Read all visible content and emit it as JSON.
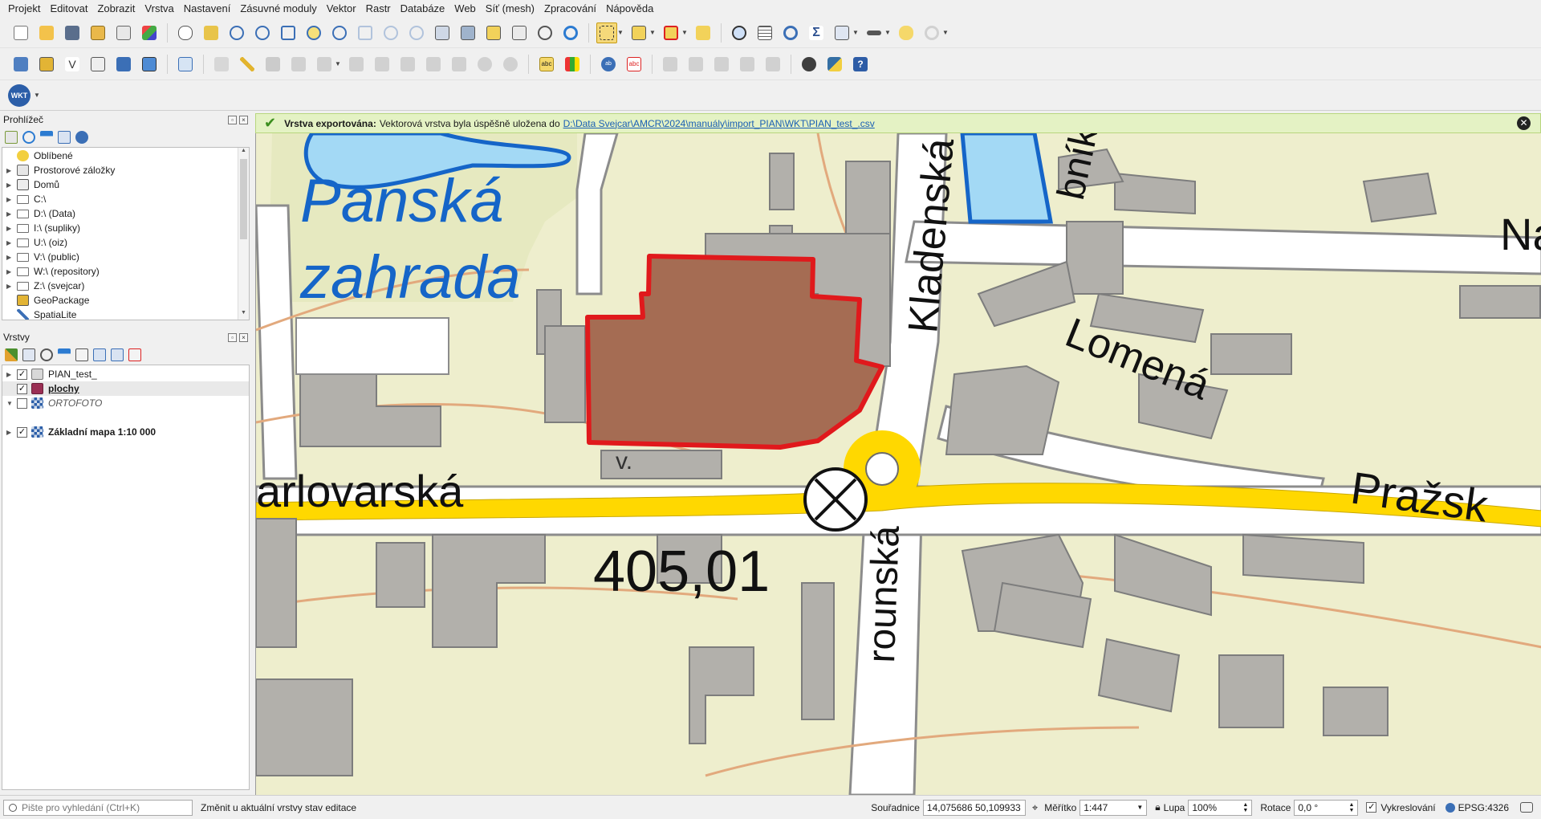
{
  "menu": [
    "Projekt",
    "Editovat",
    "Zobrazit",
    "Vrstva",
    "Nastavení",
    "Zásuvné moduly",
    "Vektor",
    "Rastr",
    "Databáze",
    "Web",
    "Síť (mesh)",
    "Zpracování",
    "Nápověda"
  ],
  "wkt_label": "WKT",
  "browser": {
    "title": "Prohlížeč",
    "items": [
      {
        "label": "Oblíbené",
        "icon": "star-icon",
        "expandable": false
      },
      {
        "label": "Prostorové záložky",
        "icon": "bookmarks-icon",
        "expandable": true
      },
      {
        "label": "Domů",
        "icon": "home-icon",
        "expandable": true
      },
      {
        "label": "C:\\",
        "icon": "folder-icon",
        "expandable": true
      },
      {
        "label": "D:\\ (Data)",
        "icon": "folder-icon",
        "expandable": true
      },
      {
        "label": "I:\\ (supliky)",
        "icon": "folder-icon",
        "expandable": true
      },
      {
        "label": "U:\\ (oiz)",
        "icon": "folder-icon",
        "expandable": true
      },
      {
        "label": "V:\\ (public)",
        "icon": "folder-icon",
        "expandable": true
      },
      {
        "label": "W:\\ (repository)",
        "icon": "folder-icon",
        "expandable": true
      },
      {
        "label": "Z:\\ (svejcar)",
        "icon": "folder-icon",
        "expandable": true
      },
      {
        "label": "GeoPackage",
        "icon": "geopackage-icon",
        "expandable": false
      },
      {
        "label": "SpatiaLite",
        "icon": "spatialite-icon",
        "expandable": false
      }
    ]
  },
  "layers": {
    "title": "Vrstvy",
    "items": [
      {
        "label": "PIAN_test_",
        "checked": true,
        "style": "normal"
      },
      {
        "label": "plochy",
        "checked": true,
        "style": "bold-underline"
      },
      {
        "label": "ORTOFOTO",
        "checked": false,
        "style": "italic"
      },
      {
        "label": "Základní mapa 1:10 000",
        "checked": true,
        "style": "bold"
      }
    ]
  },
  "message": {
    "title": "Vrstva exportována:",
    "text": "Vektorová vrstva byla úspěšně uložena do",
    "link": "D:\\Data Svejcar\\AMCR\\2024\\manuály\\import_PIAN\\WKT\\PIAN_test_.csv"
  },
  "map_labels": {
    "park1": "Panská",
    "park2": "zahrada",
    "street_kladenska": "Kladenská",
    "street_lomena": "Lomená",
    "street_karlovarska": "arlovarská",
    "street_prazska": "Pražsk",
    "street_rounska": "rounská",
    "street_rybniku": "bníku",
    "street_na": "Na",
    "spot_height": "405,01",
    "station_label": "v."
  },
  "status": {
    "search_placeholder": "Pište pro vyhledání (Ctrl+K)",
    "message": "Změnit u aktuální vrstvy stav editace",
    "coord_label": "Souřadnice",
    "coord_value": "14,075686 50,109933",
    "scale_label": "Měřítko",
    "scale_value": "1:447",
    "magnifier_label": "Lupa",
    "magnifier_value": "100%",
    "rotation_label": "Rotace",
    "rotation_value": "0,0 °",
    "render_label": "Vykreslování",
    "crs": "EPSG:4326"
  },
  "colors": {
    "polygon_fill": "#a56c53",
    "polygon_stroke": "#e0191c",
    "building": "#b2b0ab",
    "road_yellow": "#ffd800",
    "water": "#a3d9f5",
    "water_outline": "#1565c8",
    "park": "#e8eac2",
    "contour": "#e2a97d"
  }
}
